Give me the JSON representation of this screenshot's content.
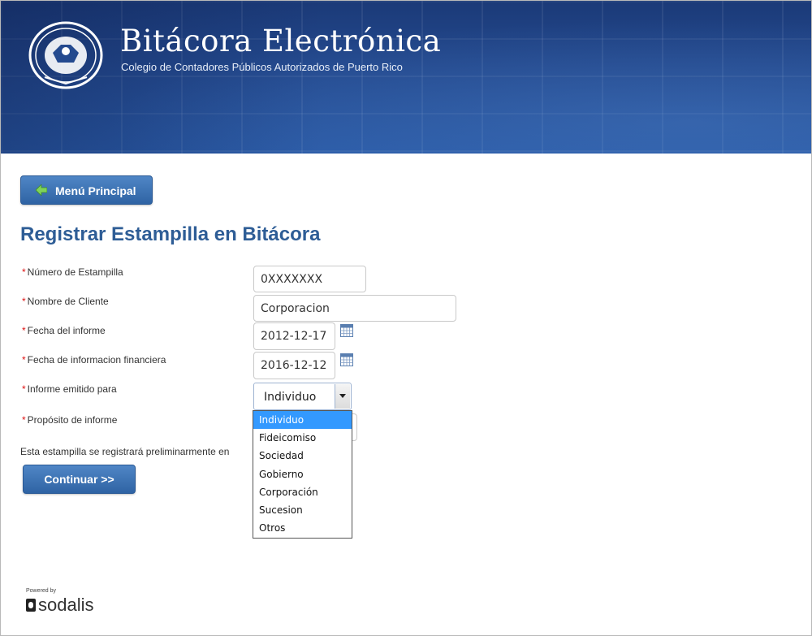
{
  "header": {
    "title": "Bitácora Electrónica",
    "subtitle": "Colegio de Contadores Públicos Autorizados de Puerto Rico",
    "logo_icon": "cpa-seal-icon"
  },
  "nav": {
    "menu_button_label": "Menú Principal",
    "menu_button_icon": "arrow-left-icon"
  },
  "page": {
    "title": "Registrar Estampilla en Bitácora",
    "required_marker": "*"
  },
  "form": {
    "numero": {
      "label": "Número de Estampilla",
      "value": "0XXXXXXX"
    },
    "cliente": {
      "label": "Nombre de Cliente",
      "value": "Corporacion"
    },
    "fecha_informe": {
      "label": "Fecha del informe",
      "value": "2012-12-17",
      "icon": "calendar-icon"
    },
    "fecha_financiera": {
      "label": "Fecha de informacion financiera",
      "value": "2016-12-12",
      "icon": "calendar-icon"
    },
    "emitido_para": {
      "label": "Informe emitido para",
      "value": "Individuo",
      "options": [
        "Individuo",
        "Fideicomiso",
        "Sociedad",
        "Gobierno",
        "Corporación",
        "Sucesion",
        "Otros"
      ],
      "selected_index": 0
    },
    "proposito": {
      "label": "Propósito de informe"
    }
  },
  "note": "Esta estampilla se registrará preliminarmente en",
  "continue_label": "Continuar >>",
  "footer": {
    "powered_by": "Powered by",
    "brand": "sodalis"
  },
  "colors": {
    "header_bg": "#244a8f",
    "button_bg": "#3a70b3",
    "title_color": "#2e5d96",
    "required_color": "#dd1111",
    "selection_color": "#3399ff"
  }
}
